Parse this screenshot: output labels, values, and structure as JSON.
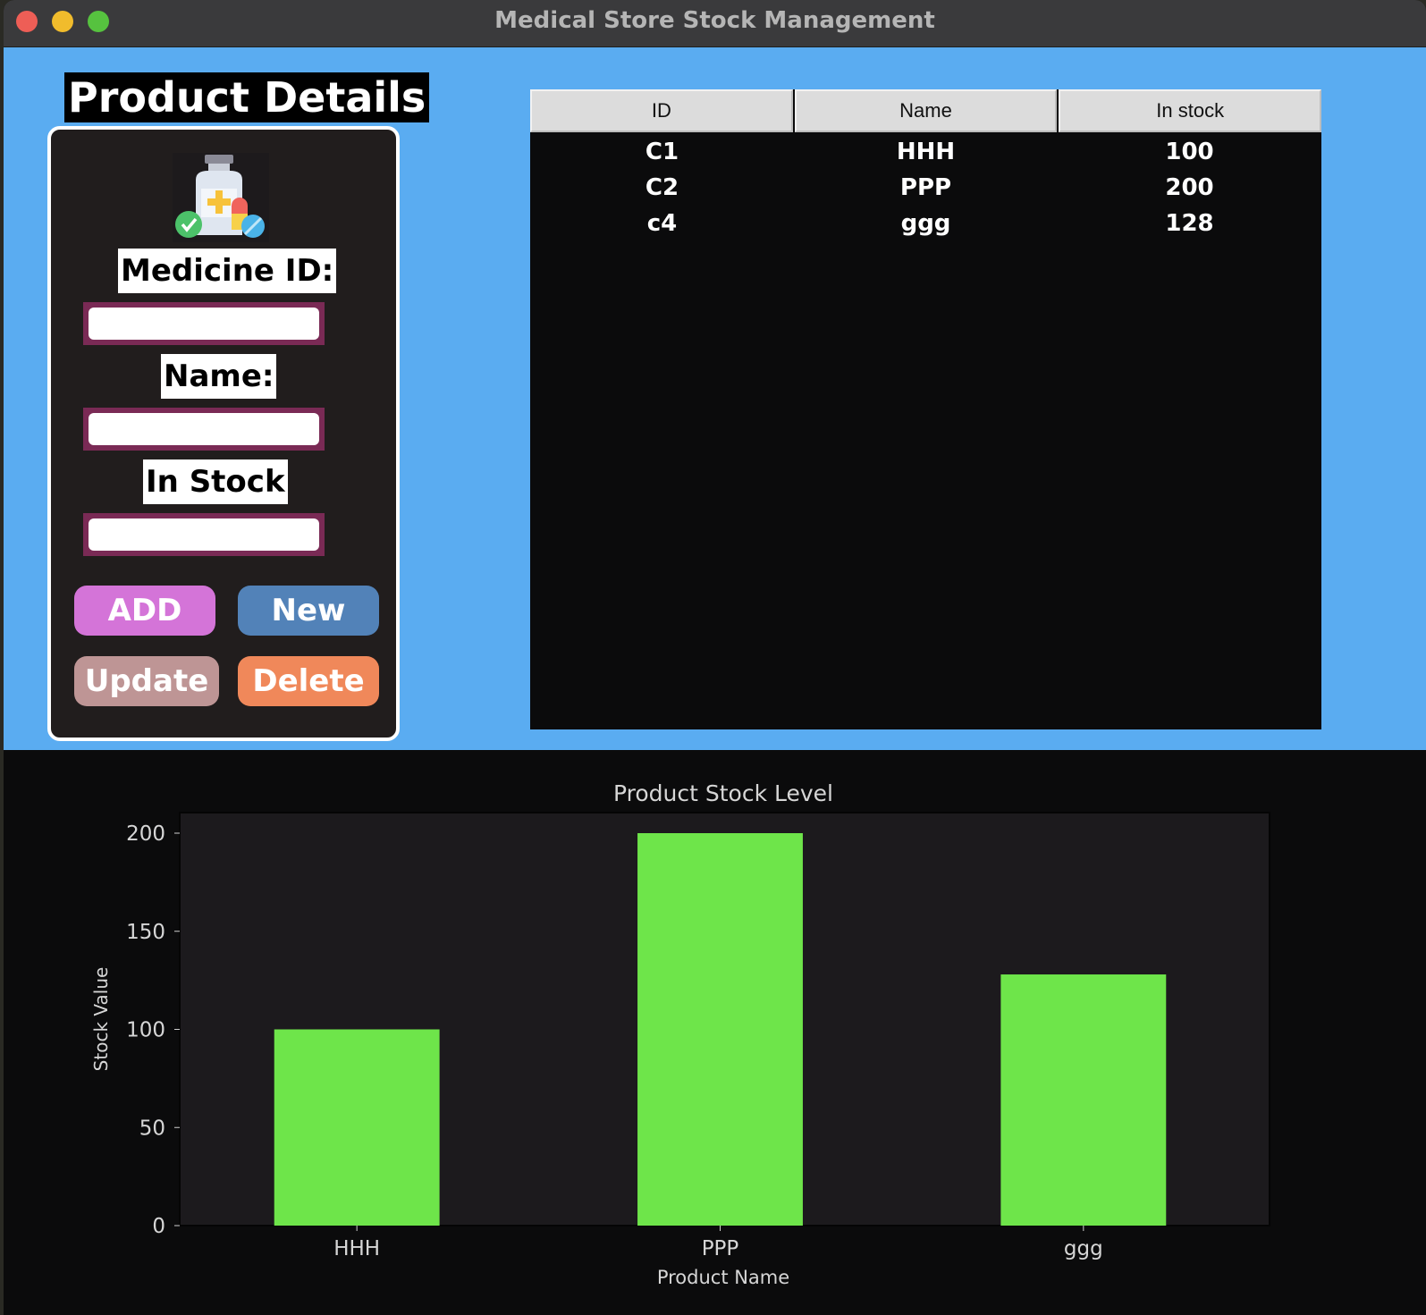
{
  "window": {
    "title": "Medical Store Stock Management"
  },
  "form": {
    "title": "Product Details",
    "icon": "medicine-bottle-pills-icon",
    "labels": {
      "medicine_id": "Medicine ID:",
      "name": "Name:",
      "in_stock": "In Stock"
    },
    "values": {
      "medicine_id": "",
      "name": "",
      "in_stock": ""
    },
    "buttons": {
      "add": "ADD",
      "new": "New",
      "update": "Update",
      "delete": "Delete"
    },
    "button_colors": {
      "add": "#d474d8",
      "new": "#5282b8",
      "update": "#be9595",
      "delete": "#f0885a"
    }
  },
  "table": {
    "columns": [
      "ID",
      "Name",
      "In stock"
    ],
    "rows": [
      [
        "C1",
        "HHH",
        "100"
      ],
      [
        "C2",
        "PPP",
        "200"
      ],
      [
        "c4",
        "ggg",
        "128"
      ]
    ]
  },
  "chart_data": {
    "type": "bar",
    "title": "Product Stock Level",
    "xlabel": "Product Name",
    "ylabel": "Stock Value",
    "categories": [
      "HHH",
      "PPP",
      "ggg"
    ],
    "values": [
      100,
      200,
      128
    ],
    "ylim": [
      0,
      210
    ],
    "yticks": [
      0,
      50,
      100,
      150,
      200
    ],
    "bar_color": "#6ee54a",
    "background": "#1c1a1d",
    "grid": false,
    "legend": "none"
  }
}
